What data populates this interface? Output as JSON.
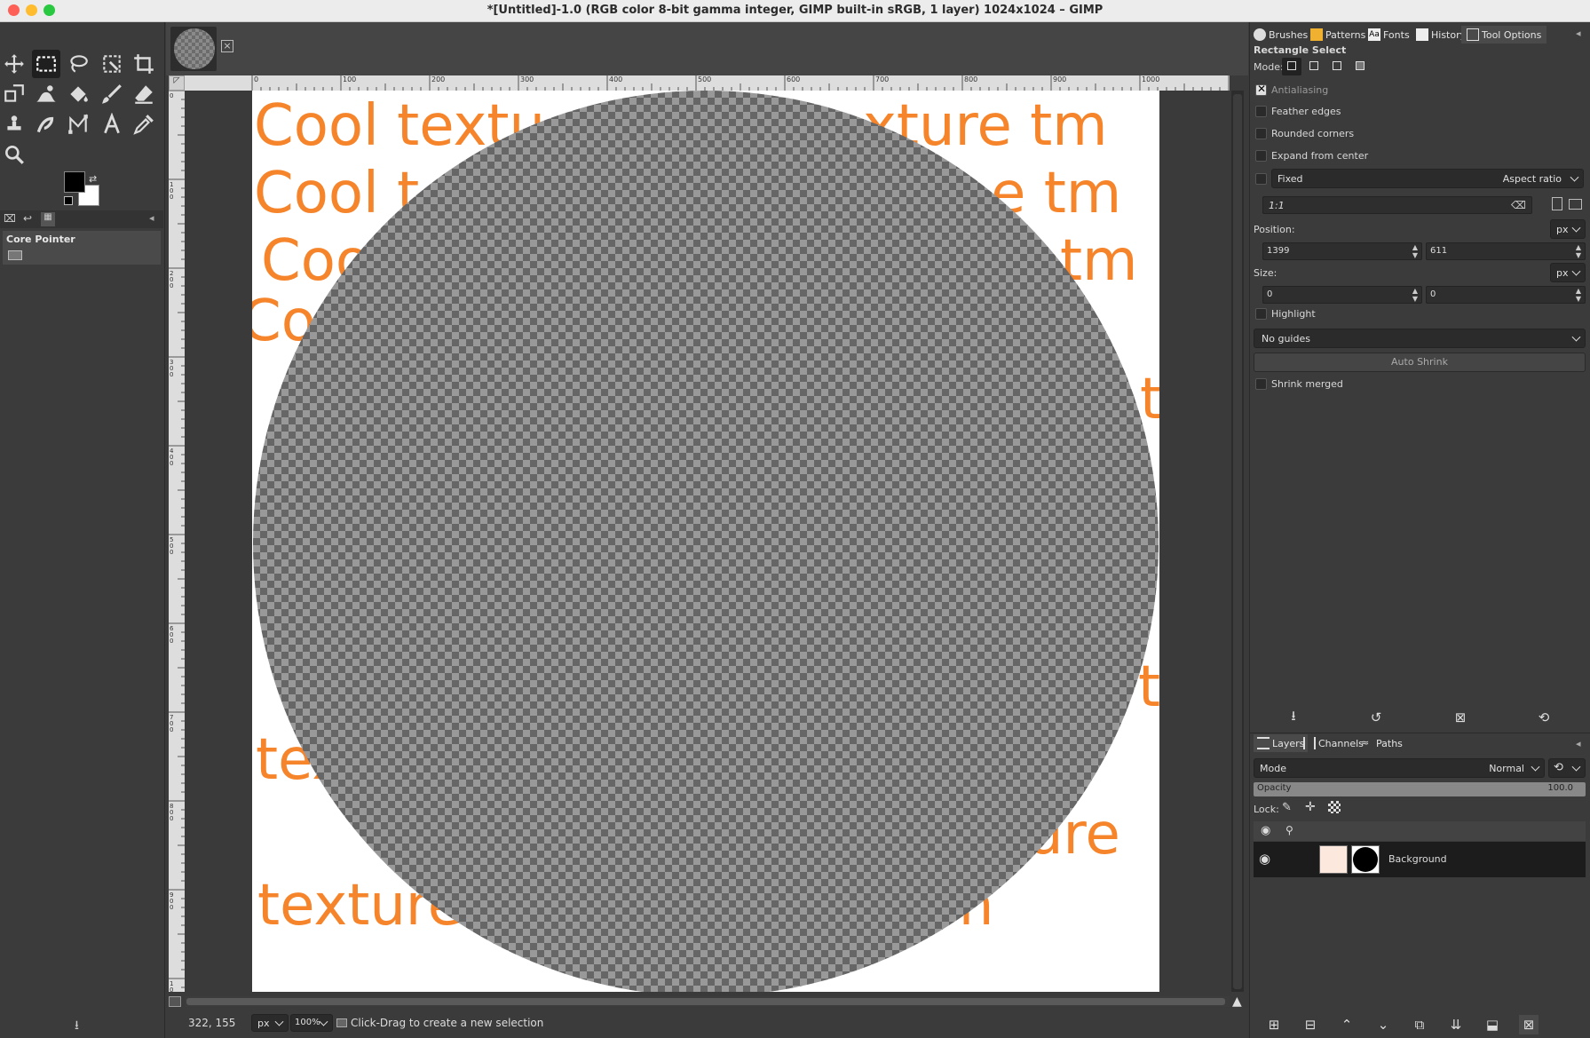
{
  "window": {
    "title": "*[Untitled]-1.0 (RGB color 8-bit gamma integer, GIMP built-in sRGB, 1 layer) 1024x1024 – GIMP"
  },
  "toolbox": {
    "tools": [
      "move-tool",
      "rect-select-tool",
      "free-select-tool",
      "fuzzy-select-tool",
      "crop-tool",
      "transform-tool",
      "warp-tool",
      "bucket-fill-tool",
      "paintbrush-tool",
      "eraser-tool",
      "clone-tool",
      "smudge-tool",
      "paths-tool",
      "text-tool",
      "color-picker-tool",
      "zoom-tool"
    ],
    "fg_color": "#000000",
    "bg_color": "#ffffff",
    "device_status_title": "Core Pointer"
  },
  "ruler": {
    "h_labels": [
      "0",
      "100",
      "200",
      "300",
      "400",
      "500",
      "600",
      "700",
      "800",
      "900",
      "1000"
    ],
    "v_labels": [
      "0",
      "100",
      "200",
      "300",
      "400",
      "500",
      "600",
      "700",
      "800",
      "900",
      "1000"
    ]
  },
  "canvas": {
    "text_color": "#f5842a",
    "text_rows": [
      "Cool textu",
      "xture tm",
      "Cool t",
      "e tm",
      "Coo",
      "tm",
      "Coo",
      "t",
      "t",
      "tex",
      "xture",
      "texture t",
      "tm"
    ]
  },
  "statusbar": {
    "coords": "322, 155",
    "unit": "px",
    "zoom": "100%",
    "message": "Click-Drag to create a new selection"
  },
  "dock": {
    "tabs": [
      "Brushes",
      "Patterns",
      "Fonts",
      "History",
      "Tool Options"
    ],
    "tool_options": {
      "title": "Rectangle Select",
      "mode_label": "Mode:",
      "antialiasing": "Antialiasing",
      "feather_edges": "Feather edges",
      "rounded_corners": "Rounded corners",
      "expand_from_center": "Expand from center",
      "fixed": "Fixed",
      "aspect_ratio": "Aspect ratio",
      "ratio_value": "1:1",
      "position_label": "Position:",
      "position_unit": "px",
      "position_x": "1399",
      "position_y": "611",
      "size_label": "Size:",
      "size_unit": "px",
      "size_w": "0",
      "size_h": "0",
      "highlight": "Highlight",
      "guides": "No guides",
      "auto_shrink": "Auto Shrink",
      "shrink_merged": "Shrink merged"
    },
    "layers_tabs": [
      "Layers",
      "Channels",
      "Paths"
    ],
    "layers": {
      "mode_label": "Mode",
      "mode_value": "Normal",
      "opacity_label": "Opacity",
      "opacity_value": "100.0",
      "lock_label": "Lock:",
      "items": [
        {
          "name": "Background"
        }
      ]
    }
  }
}
